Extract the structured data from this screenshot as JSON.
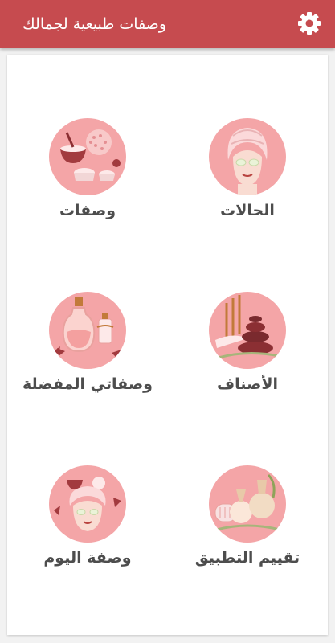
{
  "app_bar": {
    "title": "وصفات طبيعية لجمالك",
    "settings_icon": "gear-icon",
    "background_color": "#c64b4f"
  },
  "menu": {
    "circle_color": "#f4a5a7",
    "label_color": "#4d4d4d",
    "items": [
      {
        "label": "الحالات",
        "icon": "face-mask-towel-icon"
      },
      {
        "label": "وصفات",
        "icon": "spa-bowls-icon"
      },
      {
        "label": "الأصناف",
        "icon": "spa-stones-icon"
      },
      {
        "label": "وصفاتي المفضلة",
        "icon": "oil-bottles-icon"
      },
      {
        "label": "تقييم التطبيق",
        "icon": "herbal-pouches-icon"
      },
      {
        "label": "وصفة اليوم",
        "icon": "face-mask-spa-icon"
      }
    ]
  }
}
